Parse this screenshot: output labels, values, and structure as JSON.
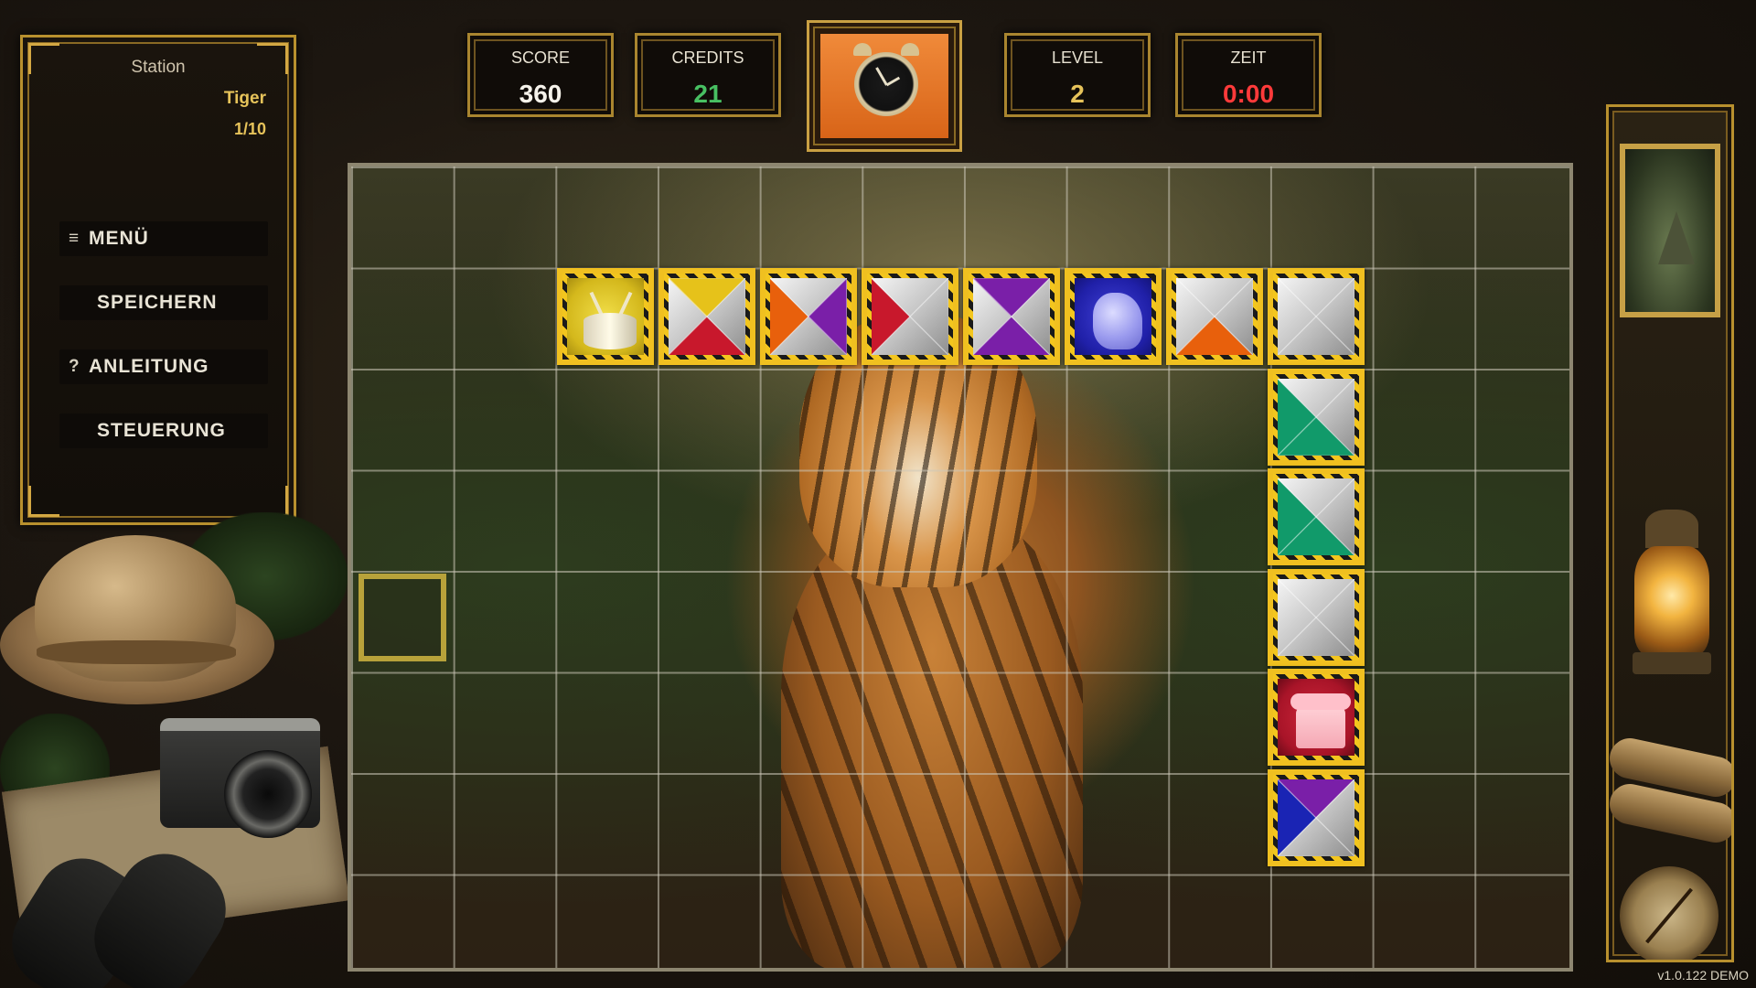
{
  "station": {
    "label": "Station",
    "name": "Tiger",
    "progress": "1/10"
  },
  "menu": {
    "items": [
      {
        "prefix": "≡",
        "label": "MENÜ"
      },
      {
        "prefix": "",
        "label": "SPEICHERN"
      },
      {
        "prefix": "?",
        "label": "ANLEITUNG"
      },
      {
        "prefix": "",
        "label": "STEUERUNG"
      }
    ]
  },
  "hud": {
    "score": {
      "label": "SCORE",
      "value": "360"
    },
    "credits": {
      "label": "CREDITS",
      "value": "21"
    },
    "level": {
      "label": "LEVEL",
      "value": "2"
    },
    "time": {
      "label": "ZEIT",
      "value": "0:00"
    },
    "next_tile_icon": "alarm-clock-icon"
  },
  "colors": {
    "score": "#f5f2ea",
    "credits": "#48c062",
    "level": "#e6c35a",
    "time": "#ff3a3a",
    "frame_gold": "#b8902e",
    "stripe_yellow": "#f3c61e",
    "red": "#c8182c",
    "purple": "#7a1fa8",
    "orange": "#e8600c",
    "green": "#119a6a",
    "blue": "#1a24b4"
  },
  "board": {
    "cols": 12,
    "rows": 8,
    "background_image": "tiger-in-jungle",
    "cursor_cell": {
      "col": 0,
      "row": 4
    },
    "tiles": [
      {
        "col": 2,
        "row": 1,
        "kind": "drum-icon"
      },
      {
        "col": 3,
        "row": 1,
        "kind": "quad",
        "top": "yellow",
        "right": "silver",
        "bottom": "red",
        "left": "silver"
      },
      {
        "col": 4,
        "row": 1,
        "kind": "quad",
        "top": "silver",
        "right": "purple",
        "bottom": "silver",
        "left": "orange"
      },
      {
        "col": 5,
        "row": 1,
        "kind": "quad",
        "top": "silver",
        "right": "silver",
        "bottom": "silver",
        "left": "red"
      },
      {
        "col": 6,
        "row": 1,
        "kind": "quad",
        "top": "purple",
        "right": "silver",
        "bottom": "purple",
        "left": "silver"
      },
      {
        "col": 7,
        "row": 1,
        "kind": "figure-icon"
      },
      {
        "col": 8,
        "row": 1,
        "kind": "quad",
        "top": "silver",
        "right": "silver",
        "bottom": "orange",
        "left": "silver"
      },
      {
        "col": 9,
        "row": 1,
        "kind": "quad",
        "top": "silver",
        "right": "silver",
        "bottom": "silver",
        "left": "silver"
      },
      {
        "col": 9,
        "row": 2,
        "kind": "quad",
        "top": "silver",
        "right": "silver",
        "bottom": "green",
        "left": "green"
      },
      {
        "col": 9,
        "row": 3,
        "kind": "quad",
        "top": "silver",
        "right": "silver",
        "bottom": "green",
        "left": "green"
      },
      {
        "col": 9,
        "row": 4,
        "kind": "quad",
        "top": "silver",
        "right": "silver",
        "bottom": "silver",
        "left": "silver"
      },
      {
        "col": 9,
        "row": 5,
        "kind": "telephone-icon"
      },
      {
        "col": 9,
        "row": 6,
        "kind": "quad",
        "top": "purple",
        "right": "silver",
        "bottom": "silver",
        "left": "blue"
      }
    ]
  },
  "version": "v1.0.122 DEMO"
}
